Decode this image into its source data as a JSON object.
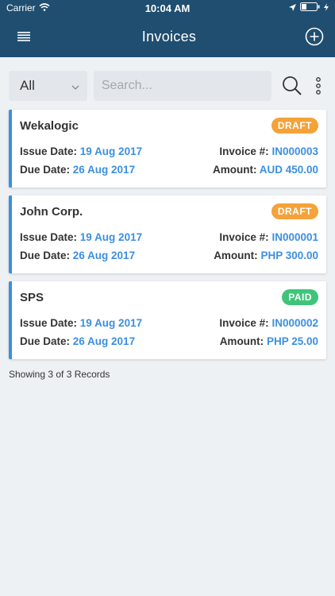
{
  "status_bar": {
    "carrier": "Carrier",
    "time": "10:04 AM"
  },
  "header": {
    "title": "Invoices",
    "menu_icon": "hamburger-menu-icon",
    "add_icon": "plus-circle-icon"
  },
  "filter": {
    "selected": "All",
    "search_placeholder": "Search..."
  },
  "labels": {
    "issue_date": "Issue Date:",
    "due_date": "Due Date:",
    "invoice_no": "Invoice #:",
    "amount": "Amount:"
  },
  "invoices": [
    {
      "client": "Wekalogic",
      "status": "DRAFT",
      "issue_date": "19 Aug 2017",
      "due_date": "26 Aug 2017",
      "invoice_no": "IN000003",
      "amount": "AUD 450.00"
    },
    {
      "client": "John Corp.",
      "status": "DRAFT",
      "issue_date": "19 Aug 2017",
      "due_date": "26 Aug 2017",
      "invoice_no": "IN000001",
      "amount": "PHP 300.00"
    },
    {
      "client": "SPS",
      "status": "PAID",
      "issue_date": "19 Aug 2017",
      "due_date": "26 Aug 2017",
      "invoice_no": "IN000002",
      "amount": "PHP 25.00"
    }
  ],
  "footer": {
    "records_text": "Showing 3 of 3 Records"
  },
  "colors": {
    "navbar": "#1f4e70",
    "accent": "#3c8fe0",
    "draft": "#f5a23a",
    "paid": "#3fc47a",
    "background": "#eef1f4"
  }
}
